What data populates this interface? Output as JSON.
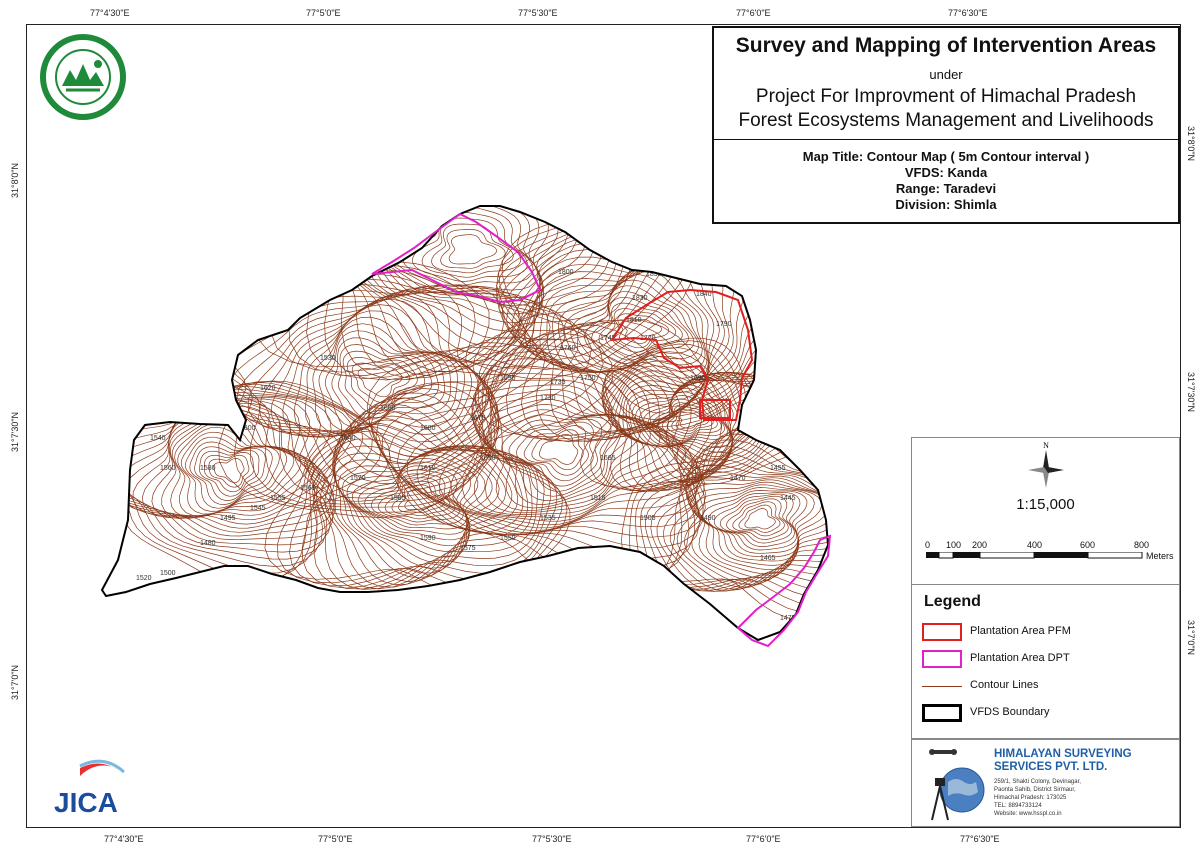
{
  "title": {
    "main": "Survey and Mapping of Intervention Areas",
    "under": "under",
    "project_line1": "Project For Improvment of Himachal Pradesh",
    "project_line2": "Forest Ecosystems Management and Livelihoods",
    "map_title": "Map Title: Contour Map ( 5m Contour interval )",
    "vfds": "VFDS: Kanda",
    "range": "Range: Taradevi",
    "division": "Division: Shimla"
  },
  "graticule": {
    "top": [
      "77°4'30\"E",
      "77°5'0\"E",
      "77°5'30\"E",
      "77°6'0\"E",
      "77°6'30\"E"
    ],
    "bottom": [
      "77°4'30\"E",
      "77°5'0\"E",
      "77°5'30\"E",
      "77°6'0\"E",
      "77°6'30\"E"
    ],
    "left": [
      "31°8'0\"N",
      "31°7'30\"N",
      "31°7'0\"N"
    ],
    "right": [
      "31°8'0\"N",
      "31°7'30\"N",
      "31°7'0\"N"
    ]
  },
  "scale": {
    "north": "N",
    "ratio": "1:15,000",
    "ticks": [
      "0",
      "100",
      "200",
      "400",
      "600",
      "800"
    ],
    "unit": "Meters"
  },
  "legend": {
    "title": "Legend",
    "items": [
      {
        "label": "Plantation Area PFM",
        "color": "#e02020",
        "kind": "polygon"
      },
      {
        "label": "Plantation Area DPT",
        "color": "#e020c8",
        "kind": "polygon"
      },
      {
        "label": "Contour Lines",
        "color": "#8b3a1a",
        "kind": "line"
      },
      {
        "label": "VFDS Boundary",
        "color": "#000000",
        "kind": "polygon"
      }
    ]
  },
  "company": {
    "name_line1": "HIMALAYAN SURVEYING",
    "name_line2": "SERVICES PVT. LTD.",
    "address": [
      "259/1, Shakti Colony, Devinagar,",
      "Paonta Sahib, District Sirmaur,",
      "Himachal Pradesh: 173025",
      "TEL: 8894733124",
      "Website: www.hsspl.co.in"
    ]
  },
  "logos": {
    "forest_dept": "Himachal Pradesh Forest Department seal",
    "jica": "JICA"
  },
  "contour_labels": [
    "1835",
    "1830",
    "1810",
    "1840",
    "1800",
    "1790",
    "1760",
    "1745",
    "1720",
    "1735",
    "1730",
    "1750",
    "1695",
    "1675",
    "1680",
    "1660",
    "1640",
    "1620",
    "1600",
    "1580",
    "1560",
    "1540",
    "1520",
    "1500",
    "1480",
    "1495",
    "1545",
    "1555",
    "1565",
    "1570",
    "1585",
    "1590",
    "1575",
    "1550",
    "1535",
    "1515",
    "1505",
    "1490",
    "1470",
    "1455",
    "1445",
    "1465",
    "1475",
    "1530",
    "1610",
    "1650",
    "1665",
    "1690"
  ],
  "colors": {
    "contour": "#8b3a1a",
    "pfm": "#e02020",
    "dpt": "#e020c8",
    "boundary": "#000000",
    "company_blue": "#1f5fa8"
  }
}
